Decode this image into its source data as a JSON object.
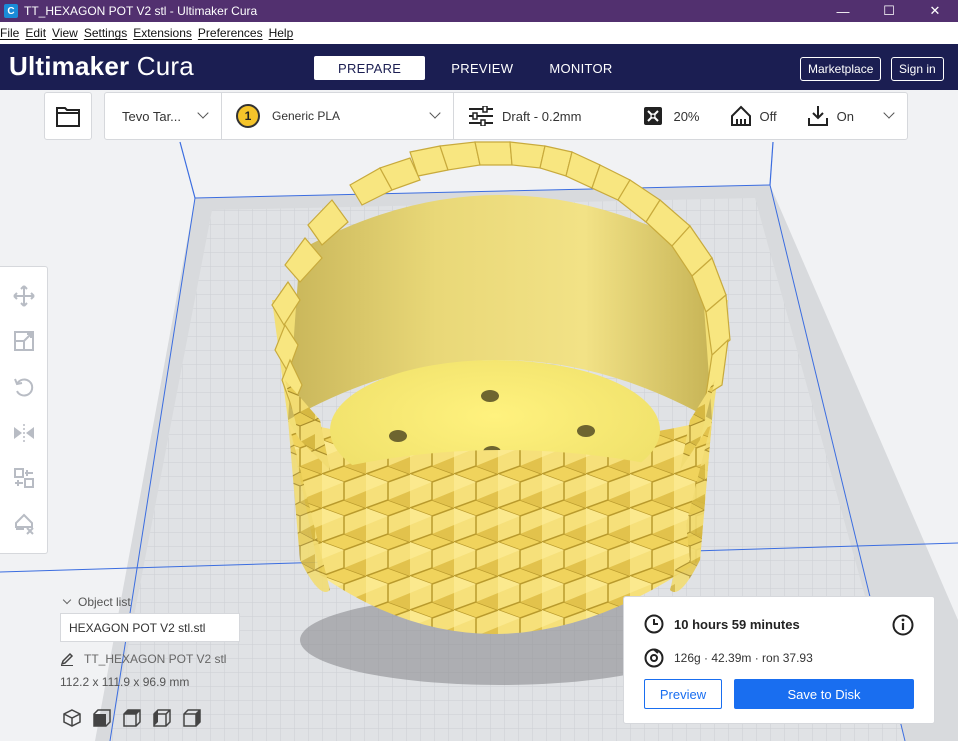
{
  "window": {
    "title": "TT_HEXAGON POT V2 stl - Ultimaker Cura",
    "app_icon": "C",
    "minimize": "—",
    "maximize": "☐",
    "close": "✕"
  },
  "menu": [
    "File",
    "Edit",
    "View",
    "Settings",
    "Extensions",
    "Preferences",
    "Help"
  ],
  "header": {
    "brand_bold": "Ultimaker",
    "brand_light": "Cura",
    "tabs": [
      "PREPARE",
      "PREVIEW",
      "MONITOR"
    ],
    "active_tab": "PREPARE",
    "marketplace": "Marketplace",
    "sign_in": "Sign in"
  },
  "printbar": {
    "printer": "Tevo Tar...",
    "extruder_number": "1",
    "material": "Generic PLA",
    "profile": "Draft - 0.2mm",
    "infill": "20%",
    "support": "Off",
    "adhesion": "On"
  },
  "object_list": {
    "header": "Object list",
    "selected": "HEXAGON POT V2 stl.stl",
    "name": "TT_HEXAGON POT V2 stl",
    "dimensions": "112.2 x 111.9 x 96.9 mm"
  },
  "print_info": {
    "time": "10 hours 59 minutes",
    "material": "126g · 42.39m · ron 37.93",
    "preview_button": "Preview",
    "save_button": "Save to Disk"
  },
  "colors": {
    "titlebar": "#52306f",
    "header": "#1b1e52",
    "accent": "#196ef0",
    "model": "#f4e27a",
    "build_plate_line": "#3b6de0"
  }
}
